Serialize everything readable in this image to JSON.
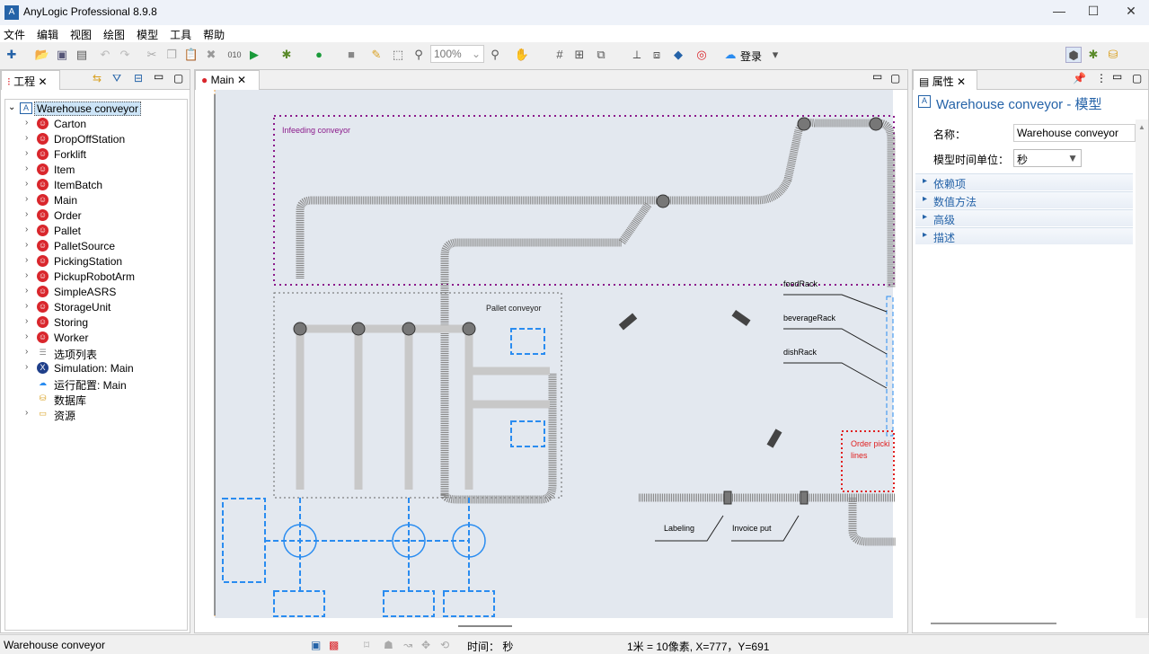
{
  "window": {
    "title": "AnyLogic Professional 8.9.8"
  },
  "menu": [
    "文件",
    "编辑",
    "视图",
    "绘图",
    "模型",
    "工具",
    "帮助"
  ],
  "toolbar": {
    "zoom": "100%",
    "login": "登录"
  },
  "project_panel": {
    "tab": "工程",
    "root": "Warehouse conveyor",
    "items": [
      {
        "label": "Carton",
        "icon": "agent-icon"
      },
      {
        "label": "DropOffStation",
        "icon": "agent-icon"
      },
      {
        "label": "Forklift",
        "icon": "agent-icon"
      },
      {
        "label": "Item",
        "icon": "agent-icon"
      },
      {
        "label": "ItemBatch",
        "icon": "agent-icon"
      },
      {
        "label": "Main",
        "icon": "agent-icon"
      },
      {
        "label": "Order",
        "icon": "agent-icon"
      },
      {
        "label": "Pallet",
        "icon": "agent-icon"
      },
      {
        "label": "PalletSource",
        "icon": "agent-icon"
      },
      {
        "label": "PickingStation",
        "icon": "agent-icon"
      },
      {
        "label": "PickupRobotArm",
        "icon": "agent-icon"
      },
      {
        "label": "SimpleASRS",
        "icon": "agent-icon"
      },
      {
        "label": "StorageUnit",
        "icon": "agent-icon"
      },
      {
        "label": "Storing",
        "icon": "agent-icon"
      },
      {
        "label": "Worker",
        "icon": "agent-icon"
      },
      {
        "label": "选项列表",
        "icon": "option-list-icon"
      },
      {
        "label": "Simulation: Main",
        "icon": "experiment-icon"
      },
      {
        "label": "运行配置: Main",
        "icon": "run-config-icon"
      },
      {
        "label": "数据库",
        "icon": "database-icon"
      },
      {
        "label": "资源",
        "icon": "folder-icon"
      }
    ]
  },
  "editor": {
    "tab": "Main",
    "labels": {
      "infeeding": "Infeeding conveyor",
      "pallet": "Pallet conveyor",
      "food": "foodRack",
      "beverage": "beverageRack",
      "dish": "dishRack",
      "order1": "Order picki",
      "order2": "lines",
      "labeling": "Labeling",
      "invoice": "Invoice put"
    }
  },
  "properties": {
    "tab": "属性",
    "title": "Warehouse conveyor - 模型",
    "name_label": "名称：",
    "name_value": "Warehouse conveyor",
    "time_unit_label": "模型时间单位：",
    "time_unit_value": "秒",
    "sections": [
      "依赖项",
      "数值方法",
      "高级",
      "描述"
    ]
  },
  "status": {
    "selection": "Warehouse conveyor",
    "time": "时间： 秒",
    "scale": "1米 = 10像素, X=777，Y=691"
  },
  "colors": {
    "accent": "#2563a8",
    "agent": "#d9262c",
    "conveyor": "#808080",
    "infeed_border": "#8b1a8b",
    "order_border": "#e02020",
    "path_blue": "#2a8cf0"
  }
}
